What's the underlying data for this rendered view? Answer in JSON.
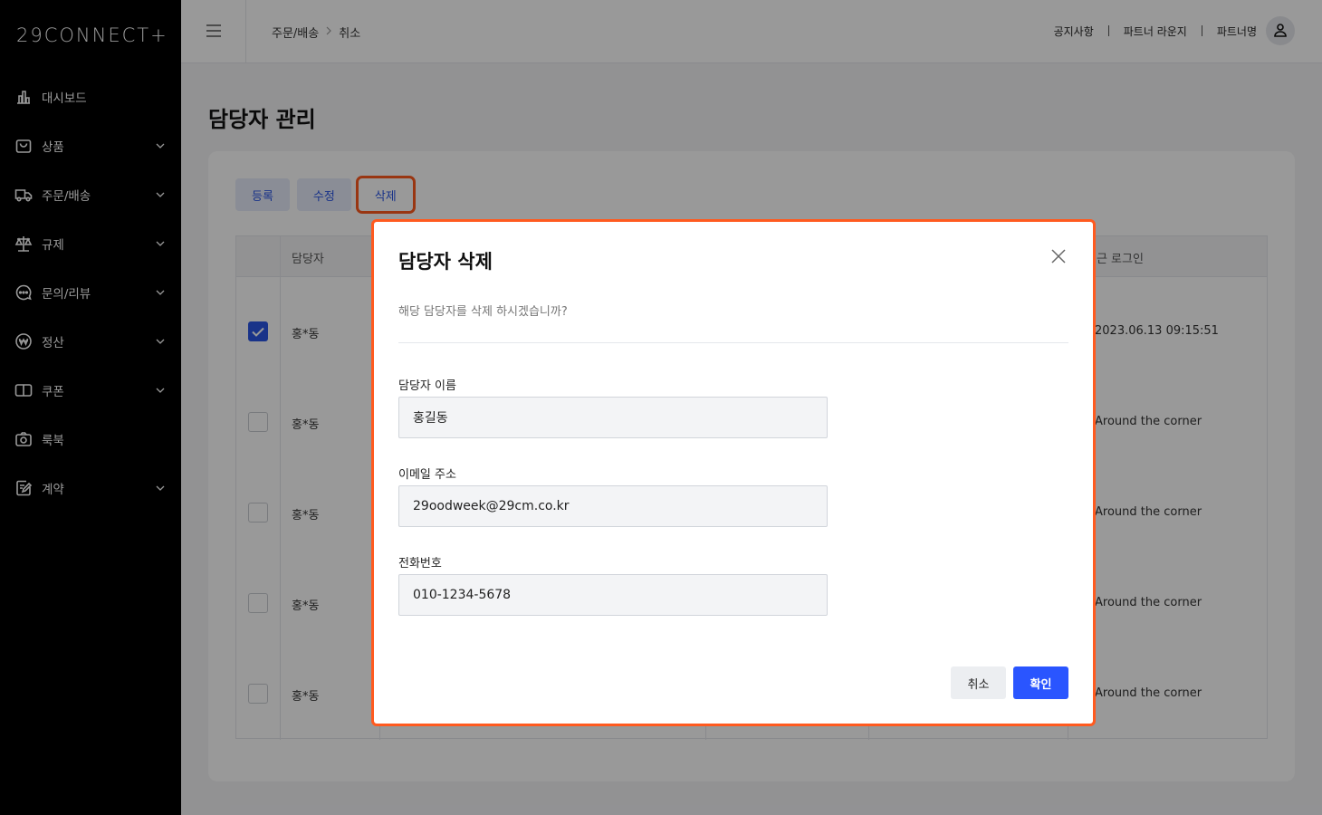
{
  "logo": "29CONNECT+",
  "sidebar": {
    "items": [
      {
        "label": "대시보드",
        "icon": "chart-icon",
        "expandable": false
      },
      {
        "label": "상품",
        "icon": "bag-icon",
        "expandable": true
      },
      {
        "label": "주문/배송",
        "icon": "truck-icon",
        "expandable": true
      },
      {
        "label": "규제",
        "icon": "scale-icon",
        "expandable": true
      },
      {
        "label": "문의/리뷰",
        "icon": "chat-icon",
        "expandable": true
      },
      {
        "label": "정산",
        "icon": "won-icon",
        "expandable": true
      },
      {
        "label": "쿠폰",
        "icon": "coupon-icon",
        "expandable": true
      },
      {
        "label": "룩북",
        "icon": "camera-icon",
        "expandable": false
      },
      {
        "label": "계약",
        "icon": "contract-icon",
        "expandable": true
      }
    ]
  },
  "header": {
    "breadcrumb": [
      "주문/배송",
      "취소"
    ],
    "links": [
      "공지사항",
      "파트너 라운지",
      "파트너명"
    ]
  },
  "page": {
    "title": "담당자 관리",
    "buttons": {
      "register": "등록",
      "edit": "수정",
      "delete": "삭제"
    },
    "table": {
      "headers": {
        "manager": "담당자",
        "last_login": "최근 로그인"
      },
      "rows": [
        {
          "name": "홍*동",
          "last": "2023.06.13 09:15:51",
          "checked": true
        },
        {
          "name": "홍*동",
          "last": "Around the corner",
          "checked": false
        },
        {
          "name": "홍*동",
          "last": "Around the corner",
          "checked": false
        },
        {
          "name": "홍*동",
          "last": "Around the corner",
          "checked": false
        },
        {
          "name": "홍*동",
          "last": "Around the corner",
          "checked": false
        }
      ]
    }
  },
  "modal": {
    "title": "담당자 삭제",
    "message": "해당 담당자를 삭제 하시겠습니까?",
    "fields": {
      "name": {
        "label": "담당자 이름",
        "value": "홍길동"
      },
      "email": {
        "label": "이메일 주소",
        "value": "29oodweek@29cm.co.kr"
      },
      "phone": {
        "label": "전화번호",
        "value": "010-1234-5678"
      }
    },
    "cancel_label": "취소",
    "confirm_label": "확인"
  },
  "colors": {
    "accent": "#2a55ff",
    "highlight": "#ff5a1f",
    "sidebar": "#000000"
  }
}
